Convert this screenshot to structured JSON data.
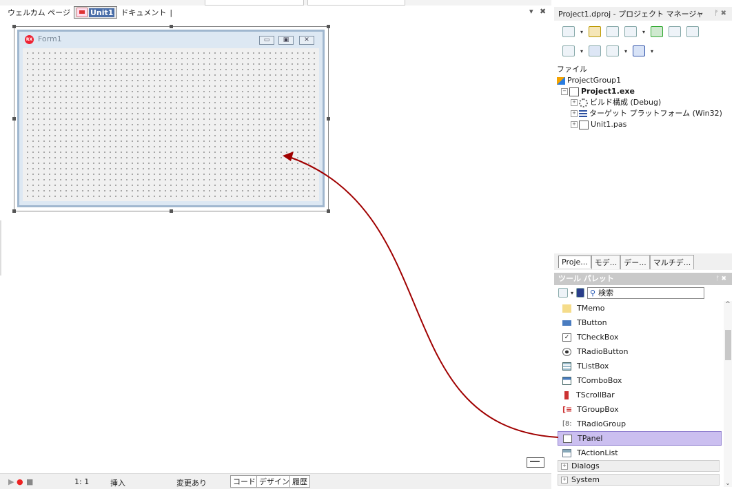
{
  "editor_tabs": {
    "welcome": "ウェルカム ページ",
    "unit1": "Unit1",
    "documents": "ドキュメント"
  },
  "form": {
    "caption": "Form1",
    "rx_badge": "RX"
  },
  "project_manager": {
    "title": "Project1.dproj - プロジェクト マネージャ",
    "files_header": "ファイル",
    "tree": {
      "group": "ProjectGroup1",
      "project": "Project1.exe",
      "build_config": "ビルド構成 (Debug)",
      "target_platform": "ターゲット プラットフォーム (Win32)",
      "unit": "Unit1.pas"
    }
  },
  "panel_tabs": [
    "Proje...",
    "モデ...",
    "デー...",
    "マルチデ..."
  ],
  "tool_palette": {
    "title": "ツール パレット",
    "search_placeholder": "検索",
    "items": [
      "TMemo",
      "TButton",
      "TCheckBox",
      "TRadioButton",
      "TListBox",
      "TComboBox",
      "TScrollBar",
      "TGroupBox",
      "TRadioGroup",
      "TPanel",
      "TActionList"
    ],
    "selected": "TPanel",
    "categories": [
      "Dialogs",
      "System"
    ]
  },
  "status_bar": {
    "position": "1:  1",
    "mode": "挿入",
    "modified": "変更あり",
    "tabs": [
      "コード",
      "デザイン",
      "履歴"
    ]
  },
  "colors": {
    "arrow": "#a00000",
    "selection": "#cbbff0"
  }
}
